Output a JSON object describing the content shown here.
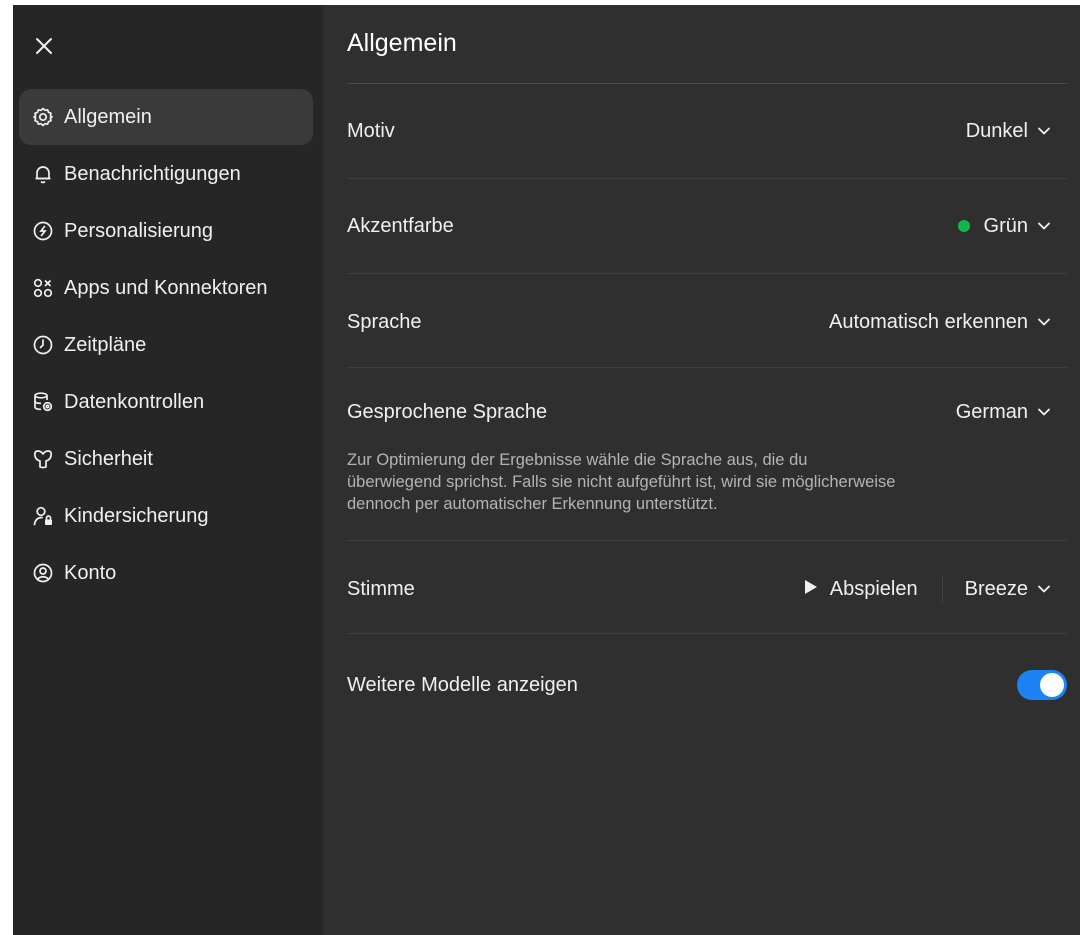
{
  "sidebar": {
    "close_icon": "close-icon",
    "items": [
      {
        "label": "Allgemein",
        "icon": "gear-icon",
        "active": true
      },
      {
        "label": "Benachrichtigungen",
        "icon": "bell-icon",
        "active": false
      },
      {
        "label": "Personalisierung",
        "icon": "personalization-icon",
        "active": false
      },
      {
        "label": "Apps und Konnektoren",
        "icon": "apps-icon",
        "active": false
      },
      {
        "label": "Zeitpläne",
        "icon": "clock-icon",
        "active": false
      },
      {
        "label": "Datenkontrollen",
        "icon": "database-gear-icon",
        "active": false
      },
      {
        "label": "Sicherheit",
        "icon": "security-icon",
        "active": false
      },
      {
        "label": "Kindersicherung",
        "icon": "parental-lock-icon",
        "active": false
      },
      {
        "label": "Konto",
        "icon": "account-icon",
        "active": false
      }
    ]
  },
  "main": {
    "title": "Allgemein",
    "theme": {
      "label": "Motiv",
      "value": "Dunkel"
    },
    "accent": {
      "label": "Akzentfarbe",
      "value": "Grün",
      "color": "#10b84a"
    },
    "language": {
      "label": "Sprache",
      "value": "Automatisch erkennen"
    },
    "spoken_language": {
      "label": "Gesprochene Sprache",
      "value": "German",
      "description_lines": [
        "Zur Optimierung der Ergebnisse wähle die Sprache aus, die du",
        "überwiegend sprichst. Falls sie nicht aufgeführt ist, wird sie möglicherweise",
        "dennoch per automatischer Erkennung unterstützt."
      ]
    },
    "voice": {
      "label": "Stimme",
      "play_label": "Abspielen",
      "value": "Breeze"
    },
    "more_models": {
      "label": "Weitere Modelle anzeigen",
      "enabled": true,
      "color": "#1d82f3"
    }
  }
}
